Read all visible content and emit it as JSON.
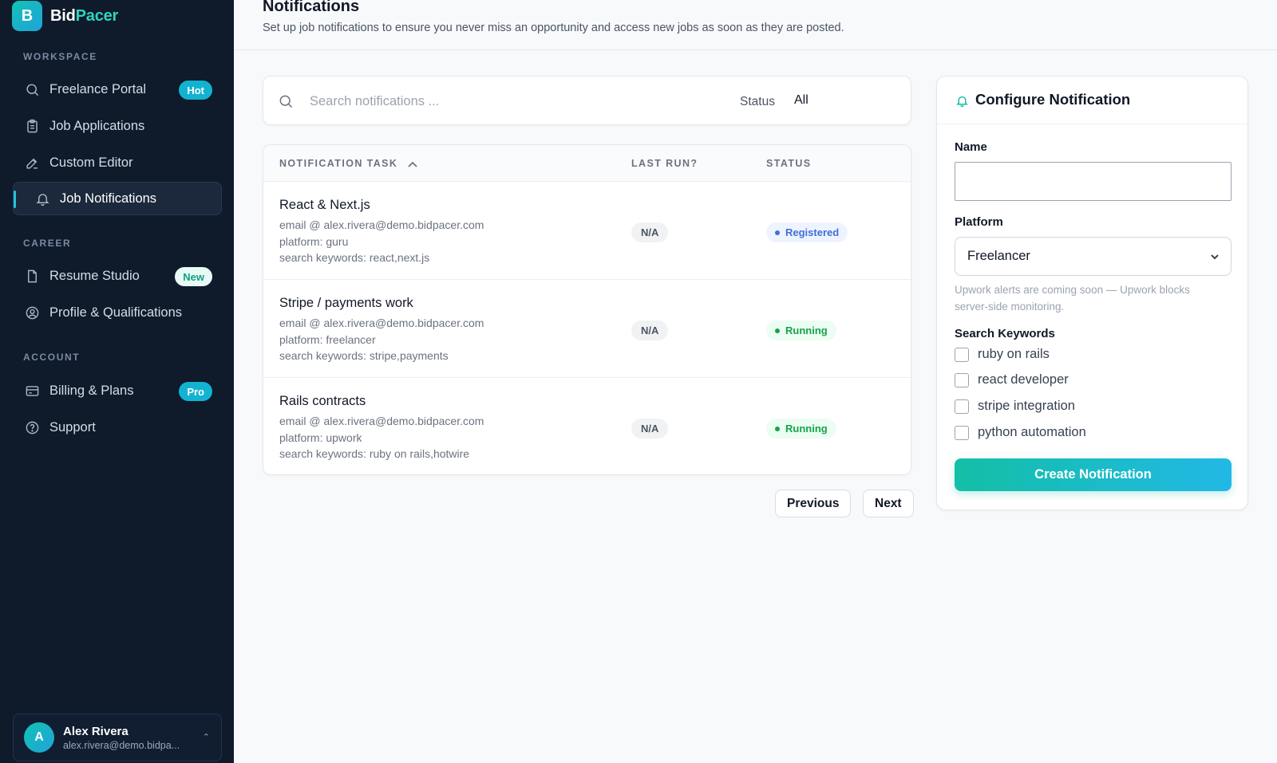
{
  "brand": {
    "logo_letter": "B",
    "name_part1": "Bid",
    "name_part2": "Pacer"
  },
  "sidebar": {
    "sections": {
      "workspace": "WORKSPACE",
      "career": "CAREER",
      "account": "ACCOUNT"
    },
    "items": [
      {
        "label": "Freelance Portal",
        "icon": "search-icon",
        "badge": "Hot"
      },
      {
        "label": "Job Applications",
        "icon": "clipboard-icon"
      },
      {
        "label": "Custom Editor",
        "icon": "edit-icon"
      },
      {
        "label": "Job Notifications",
        "icon": "bell-icon",
        "active": true
      },
      {
        "label": "Resume Studio",
        "icon": "document-icon",
        "badge": "New"
      },
      {
        "label": "Profile & Qualifications",
        "icon": "user-circle-icon"
      },
      {
        "label": "Billing & Plans",
        "icon": "credit-card-icon",
        "badge": "Pro"
      },
      {
        "label": "Support",
        "icon": "help-circle-icon"
      }
    ],
    "user": {
      "initial": "A",
      "name": "Alex Rivera",
      "email": "alex.rivera@demo.bidpa..."
    }
  },
  "header": {
    "title": "Notifications",
    "subtitle": "Set up job notifications to ensure you never miss an opportunity and access new jobs as soon as they are posted."
  },
  "search": {
    "placeholder": "Search notifications ...",
    "status_label": "Status",
    "status_value": "All"
  },
  "table": {
    "columns": [
      "NOTIFICATION TASK",
      "LAST RUN?",
      "STATUS"
    ],
    "rows": [
      {
        "title": "React & Next.js",
        "email": "email @ alex.rivera@demo.bidpacer.com",
        "platform": "platform: guru",
        "keywords": "search keywords: react,next.js",
        "last_run": "N/A",
        "status": "Registered"
      },
      {
        "title": "Stripe / payments work",
        "email": "email @ alex.rivera@demo.bidpacer.com",
        "platform": "platform: freelancer",
        "keywords": "search keywords: stripe,payments",
        "last_run": "N/A",
        "status": "Running"
      },
      {
        "title": "Rails contracts",
        "email": "email @ alex.rivera@demo.bidpacer.com",
        "platform": "platform: upwork",
        "keywords": "search keywords: ruby on rails,hotwire",
        "last_run": "N/A",
        "status": "Running"
      }
    ]
  },
  "pagination": {
    "previous": "Previous",
    "next": "Next"
  },
  "config": {
    "title": "Configure Notification",
    "name_label": "Name",
    "name_value": "",
    "platform_label": "Platform",
    "platform_value": "Freelancer",
    "platform_helper": "Upwork alerts are coming soon — Upwork blocks server-side monitoring.",
    "keywords_label": "Search Keywords",
    "keywords": [
      "ruby on rails",
      "react developer",
      "stripe integration",
      "python automation"
    ],
    "create_button": "Create Notification"
  },
  "colors": {
    "sidebar_bg": "#0f1a2b",
    "accent": "#14b8a6",
    "accent_blue": "#22b8e6",
    "registered": "#3f6fd8",
    "running": "#16a34a"
  }
}
